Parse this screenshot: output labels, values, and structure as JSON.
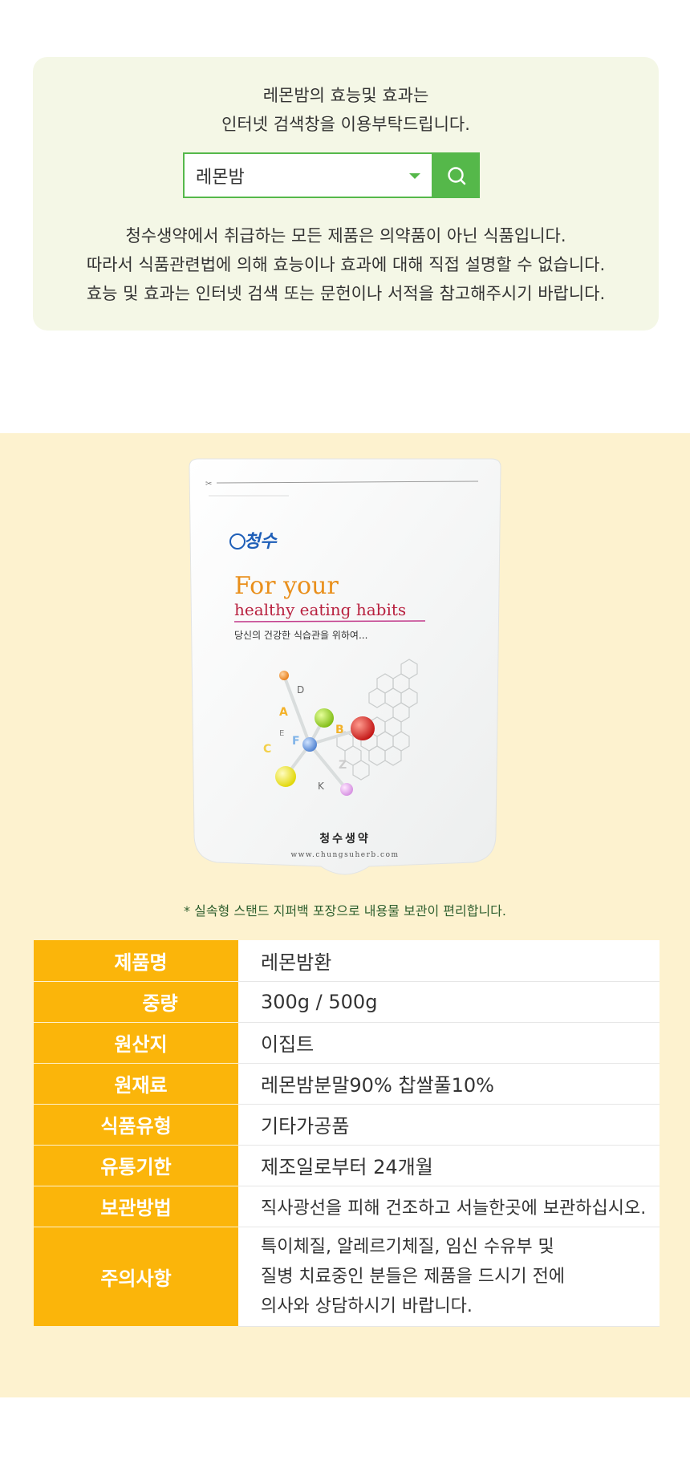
{
  "notice": {
    "intro_line1": "레몬밤의 효능및 효과는",
    "intro_line2": "인터넷 검색창을 이용부탁드립니다.",
    "search_value": "레몬밤",
    "desc_line1": "청수생약에서 취급하는 모든 제품은 의약품이 아닌 식품입니다.",
    "desc_line2": "따라서 식품관련법에 의해 효능이나 효과에 대해 직접 설명할 수 없습니다.",
    "desc_line3": "효능 및 효과는 인터넷 검색 또는 문헌이나 서적을 참고해주시기 바랍니다."
  },
  "pouch": {
    "tagline_1": "For your",
    "tagline_2": "healthy eating habits",
    "tagline_kr": "당신의 건강한 식습관을 위하여...",
    "brand": "청수생약",
    "url": "www.chungsuherb.com",
    "logo_text": "청수",
    "vitamins": [
      "D",
      "A",
      "B",
      "E",
      "F",
      "C",
      "Z",
      "K"
    ]
  },
  "caption": "* 실속형 스탠드 지퍼백 포장으로 내용물 보관이 편리합니다.",
  "spec": {
    "name_label": "제품명",
    "name_value": "레몬밤환",
    "weight_label": "중량",
    "weight_value": "300g / 500g",
    "origin_label": "원산지",
    "origin_value": "이집트",
    "ingredient_label": "원재료",
    "ingredient_value": "레몬밤분말90% 찹쌀풀10%",
    "type_label": "식품유형",
    "type_value": "기타가공품",
    "expiry_label": "유통기한",
    "expiry_value": "제조일로부터 24개월",
    "storage_label": "보관방법",
    "storage_value": "직사광선을 피해 건조하고 서늘한곳에 보관하십시오.",
    "caution_label": "주의사항",
    "caution_line1": "특이체질, 알레르기체질, 임신 수유부 및",
    "caution_line2": "질병 치료중인 분들은 제품을 드시기 전에",
    "caution_line3": "의사와 상담하시기 바랍니다."
  },
  "colors": {
    "notice_bg": "#f4f7e6",
    "search_green": "#55b84a",
    "section_bg": "#fdf2cf",
    "label_orange": "#fbb50a"
  }
}
